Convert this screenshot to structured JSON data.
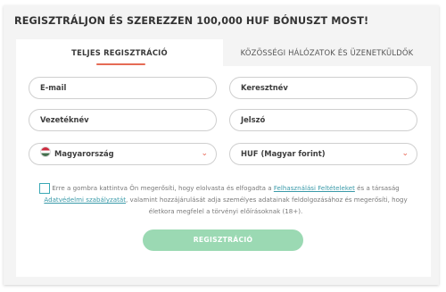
{
  "title": "REGISZTRÁLJON ÉS SZEREZZEN 100,000 HUF BÓNUSZT MOST!",
  "tabs": [
    {
      "label": "TELJES REGISZTRÁCIÓ",
      "active": true
    },
    {
      "label": "KÖZÖSSÉGI HÁLÓZATOK ÉS ÜZENETKÜLDŐK",
      "active": false
    }
  ],
  "fields": {
    "email": "E-mail",
    "first_name": "Keresztnév",
    "last_name": "Vezetéknév",
    "password": "Jelszó",
    "country": "Magyarország",
    "currency": "HUF (Magyar forint)"
  },
  "consent": {
    "part1": "Erre a gombra kattintva Ön megerősíti, hogy elolvasta és elfogadta a ",
    "link1": "Felhasználási Feltételeket",
    "part2": " és a társaság ",
    "link2": "Adatvédelmi szabályzatát",
    "part3": ", valamint hozzájárulását adja személyes adatainak feldolgozásához és megerősíti, hogy életkora megfelel a törvényi előírásoknak (18+)."
  },
  "submit_label": "REGISZTRÁCIÓ",
  "colors": {
    "accent": "#e56b55",
    "link": "#3a9aa9",
    "button": "#9bd9b3"
  },
  "icons": {
    "country_flag": "hungary-flag-icon",
    "dropdown": "chevron-down-icon"
  }
}
